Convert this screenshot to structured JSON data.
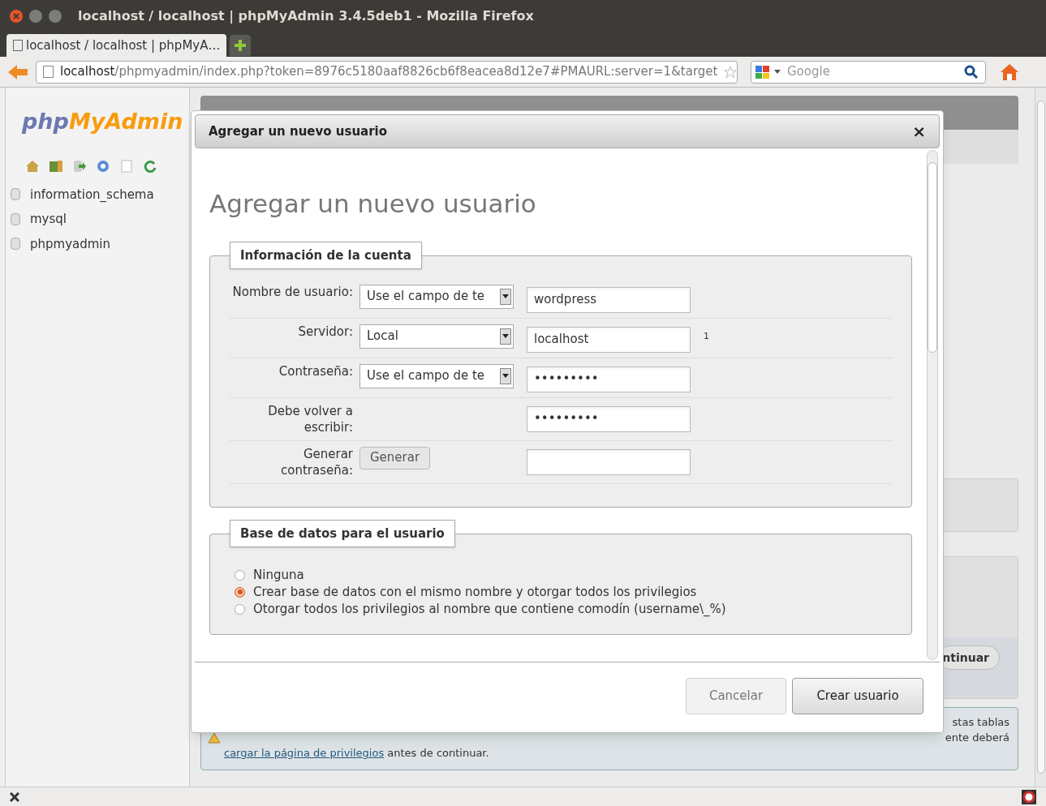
{
  "window": {
    "title": "localhost / localhost | phpMyAdmin 3.4.5deb1 - Mozilla Firefox"
  },
  "tabs": [
    {
      "label": "localhost / localhost | phpMyA…",
      "selected": true
    }
  ],
  "address_bar": {
    "host": "localhost",
    "path": "/phpmyadmin/index.php?token=8976c5180aaf8826cb6f8eacea8d12e7#PMAURL:server=1&target"
  },
  "search": {
    "placeholder": "Google"
  },
  "sidebar": {
    "logo_php": "php",
    "logo_rest": "MyAdmin",
    "databases": [
      "information_schema",
      "mysql",
      "phpmyadmin"
    ]
  },
  "background": {
    "continue_button": "ntinuar",
    "notice_line_1": "stas tablas",
    "notice_line_2": "ente deberá",
    "notice_link": "cargar la página de privilegios",
    "notice_tail": " antes de continuar."
  },
  "dialog": {
    "title": "Agregar un nuevo usuario",
    "close": "×",
    "heading": "Agregar un nuevo usuario",
    "account": {
      "legend": "Información de la cuenta",
      "rows": [
        {
          "kind": "select",
          "label": "Nombre de usuario:",
          "select": "Use el campo de te",
          "value": "wordpress"
        },
        {
          "kind": "select",
          "label": "Servidor:",
          "select": "Local",
          "value": "localhost",
          "note": "1"
        },
        {
          "kind": "select",
          "label": "Contraseña:",
          "select": "Use el campo de te",
          "value": "•••••••••"
        },
        {
          "kind": "plain",
          "label": "Debe volver a escribir:",
          "value": "•••••••••"
        },
        {
          "kind": "button",
          "label": "Generar contraseña:",
          "button": "Generar"
        }
      ]
    },
    "database": {
      "legend": "Base de datos para el usuario",
      "options": [
        {
          "label": "Ninguna",
          "selected": false
        },
        {
          "label": "Crear base de datos con el mismo nombre y otorgar todos los privilegios",
          "selected": true
        },
        {
          "label": "Otorgar todos los privilegios al nombre que contiene comodín (username\\_%)",
          "selected": false
        }
      ]
    },
    "buttons": [
      {
        "label": "Cancelar",
        "primary": false
      },
      {
        "label": "Crear usuario",
        "primary": true
      }
    ]
  }
}
